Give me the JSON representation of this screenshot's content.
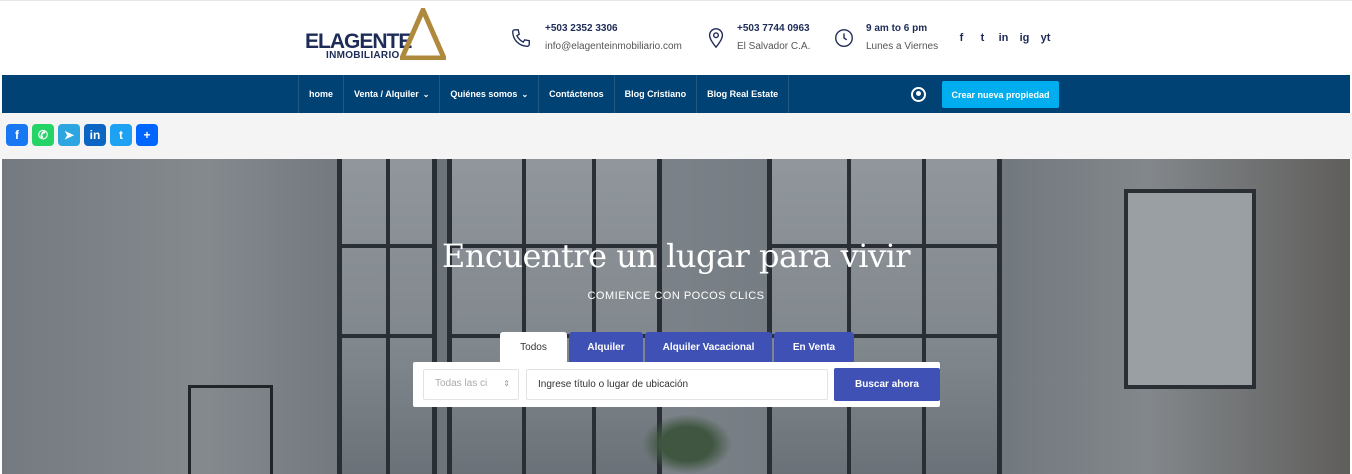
{
  "logo": {
    "word": "ELAGENTE",
    "sub": "INMOBILIARIO"
  },
  "header": {
    "phone1": {
      "line1": "+503 2352 3306",
      "line2": "info@elagenteinmobiliario.com",
      "icon": "phone-icon"
    },
    "phone2": {
      "line1": "+503 7744 0963",
      "line2": "El Salvador C.A.",
      "icon": "location-pin-icon"
    },
    "hours": {
      "line1": "9 am to 6 pm",
      "line2": "Lunes a Viernes",
      "icon": "clock-icon"
    },
    "social": [
      "f",
      "t",
      "in",
      "ig",
      "yt"
    ]
  },
  "nav": {
    "items": [
      {
        "label": "home",
        "chevron": ""
      },
      {
        "label": "Venta / Alquiler",
        "chevron": "⌄"
      },
      {
        "label": "Quiénes somos",
        "chevron": "⌄"
      },
      {
        "label": "Contáctenos",
        "chevron": ""
      },
      {
        "label": "Blog Cristiano",
        "chevron": ""
      },
      {
        "label": "Blog Real Estate",
        "chevron": ""
      }
    ],
    "cta": "Crear nueva propiedad"
  },
  "share": [
    {
      "glyph": "f",
      "color": "#1877f2"
    },
    {
      "glyph": "✆",
      "color": "#25d366"
    },
    {
      "glyph": "➤",
      "color": "#2ca5e0"
    },
    {
      "glyph": "in",
      "color": "#0a66c2"
    },
    {
      "glyph": "t",
      "color": "#1da1f2"
    },
    {
      "glyph": "+",
      "color": "#0166ff"
    }
  ],
  "hero": {
    "title": "Encuentre un lugar para vivir",
    "subtitle": "COMIENCE CON POCOS CLICS",
    "tabs": [
      "Todos",
      "Alquiler",
      "Alquiler Vacacional",
      "En Venta"
    ],
    "select_value": "Todas las ci",
    "search_placeholder": "Ingrese título o lugar de ubicación",
    "button": "Buscar ahora"
  },
  "colors": {
    "nav": "#004274",
    "cta": "#00aeef",
    "accent": "#3f51b5"
  }
}
